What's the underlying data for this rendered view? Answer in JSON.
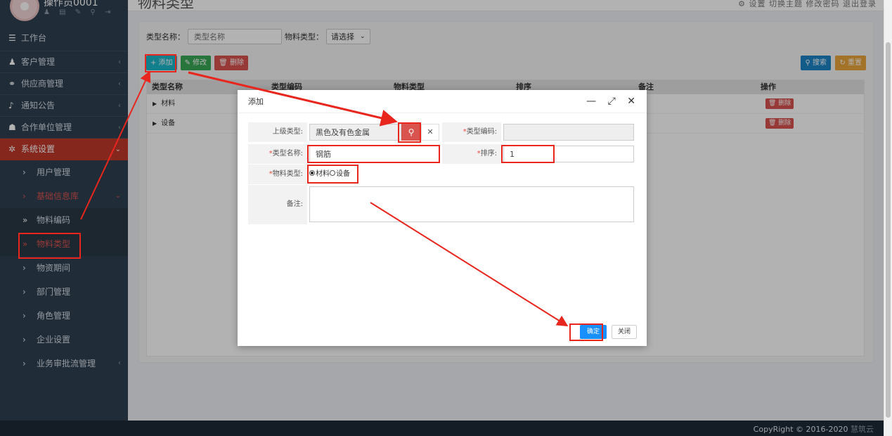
{
  "sidebar": {
    "username": "操作员0001",
    "user_icons": "♟ ▤ ✎ ⚲ ⇥",
    "menu": [
      {
        "label": "工作台",
        "icon": "☰",
        "arrow": ""
      },
      {
        "label": "客户管理",
        "icon": "♟",
        "arrow": "‹"
      },
      {
        "label": "供应商管理",
        "icon": "⚭",
        "arrow": "‹"
      },
      {
        "label": "通知公告",
        "icon": "♪",
        "arrow": "‹"
      },
      {
        "label": "合作单位管理",
        "icon": "☗",
        "arrow": "‹"
      },
      {
        "label": "系统设置",
        "icon": "✲",
        "arrow": "⌄"
      },
      {
        "label": "用户管理",
        "icon": "›",
        "arrow": ""
      },
      {
        "label": "基础信息库",
        "icon": "›",
        "arrow": "⌄"
      },
      {
        "label": "物料编码",
        "icon": "»",
        "arrow": ""
      },
      {
        "label": "物料类型",
        "icon": "»",
        "arrow": ""
      },
      {
        "label": "物资期间",
        "icon": "›",
        "arrow": ""
      },
      {
        "label": "部门管理",
        "icon": "›",
        "arrow": ""
      },
      {
        "label": "角色管理",
        "icon": "›",
        "arrow": ""
      },
      {
        "label": "企业设置",
        "icon": "›",
        "arrow": ""
      },
      {
        "label": "业务审批流管理",
        "icon": "›",
        "arrow": "‹"
      }
    ]
  },
  "header": {
    "page_title": "物料类型",
    "top_menu": "⚙ 设置   切换主题   修改密码   退出登录"
  },
  "filter": {
    "name_label": "类型名称：",
    "name_placeholder": "类型名称",
    "type_label": "物料类型：",
    "type_value": "请选择"
  },
  "toolbar": {
    "add": "+ 添加",
    "edit": "✎ 修改",
    "delete": "🗑 删除",
    "search": "⚲ 搜索",
    "reset": "↻ 重置"
  },
  "table": {
    "columns": [
      "类型名称",
      "类型编码",
      "物料类型",
      "排序",
      "备注",
      "操作"
    ],
    "rows": [
      {
        "name": "材料",
        "action": "🗑 删除"
      },
      {
        "name": "设备",
        "action": "🗑 删除"
      }
    ]
  },
  "modal": {
    "title": "添加",
    "controls": "— ⤢ ✕",
    "parent_label": "上级类型:",
    "parent_value": "黑色及有色金属",
    "code_label": "类型编码:",
    "code_value": "",
    "name_label": "类型名称:",
    "name_value": "钢筋",
    "sort_label": "排序:",
    "sort_value": "1",
    "material_type_label": "物料类型:",
    "option_material": "材料",
    "option_equipment": "设备",
    "remark_label": "备注:",
    "confirm": "确定",
    "close": "关闭",
    "required_mark": "*"
  },
  "footer": {
    "copyright": "CopyRight © 2016-2020 ",
    "brand": "慧筑云"
  },
  "colors": {
    "annotation": "#e8261d",
    "sidebar_bg": "#2f4050",
    "confirm_blue": "#1890ff"
  }
}
